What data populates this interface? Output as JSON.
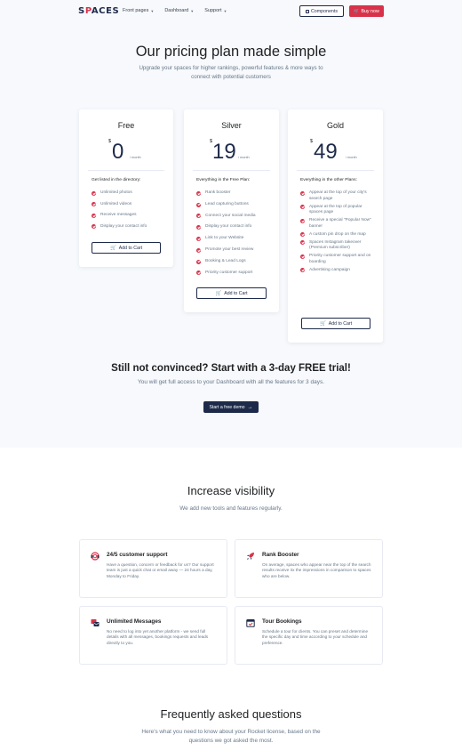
{
  "nav": {
    "logo_prefix": "S",
    "logo_accent": "P",
    "logo_suffix": "ACES",
    "menu": [
      {
        "label": "Front pages"
      },
      {
        "label": "Dashboard"
      },
      {
        "label": "Support"
      }
    ],
    "components_label": "Components",
    "buy_label": "Buy now"
  },
  "hero": {
    "title": "Our pricing plan made simple",
    "subtitle": "Upgrade your spaces for higher rankings, powerful features & more ways to connect with potential customers"
  },
  "plans": [
    {
      "name": "Free",
      "currency": "$",
      "price": "0",
      "period": "/ month",
      "features_title": "Get listed in the directory:",
      "features": [
        "Unlimited photos",
        "Unlimited videos",
        "Receive messages",
        "Display your contact info"
      ],
      "cta": "Add to Cart"
    },
    {
      "name": "Silver",
      "currency": "$",
      "price": "19",
      "period": "/ month",
      "features_title": "Everything in the Free Plan:",
      "features": [
        "Rank booster",
        "Lead capturing buttons",
        "Connect your social media",
        "Display your contact info",
        "Link to your Website",
        "Promote your best review",
        "Booking & Lead Logs",
        "Priority customer support"
      ],
      "cta": "Add to Cart"
    },
    {
      "name": "Gold",
      "currency": "$",
      "price": "49",
      "period": "/ month",
      "features_title": "Everything in the other Plans:",
      "features": [
        "Appear at the top of your city's search page",
        "Appear at the top of popular spaces page",
        "Receive a special \"Popular Now\" banner",
        "A custom pin drop on the map",
        "Spaces Instagram takeover (Premium subscriber)",
        "Priority customer support and on boarding",
        "Advertising campaign"
      ],
      "cta": "Add to Cart"
    }
  ],
  "trial": {
    "title": "Still not convinced? Start with a 3-day FREE trial!",
    "subtitle": "You will get full access to your Dashboard with all the features for 3 days.",
    "button": "Start a free demo"
  },
  "visibility": {
    "title": "Increase visibility",
    "subtitle": "We add new tools and features regularly.",
    "features": [
      {
        "title": "24/5 customer support",
        "text": "Have a question, concern or feedback for us? Our support team is just a quick chat or email away — 24 hours a day, Monday to Friday.",
        "icon": "support-icon"
      },
      {
        "title": "Rank Booster",
        "text": "On average, spaces who appear near the top of the search results receive 3x the impressions in comparison to spaces who are below.",
        "icon": "rocket-icon"
      },
      {
        "title": "Unlimited Messages",
        "text": "No need to log into yet another platform - we send full details with all messages, bookings requests and leads directly to you.",
        "icon": "messages-icon"
      },
      {
        "title": "Tour Bookings",
        "text": "Schedule a tour for clients. You can preset and determine the specific day and time according to your schedule and preference.",
        "icon": "calendar-icon"
      }
    ]
  },
  "faq": {
    "title": "Frequently asked questions",
    "subtitle": "Here's what you need to know about your Rocket license, based on the questions we got asked the most."
  },
  "colors": {
    "accent": "#d7324a",
    "navy": "#1e2a4a",
    "muted": "#677788"
  }
}
